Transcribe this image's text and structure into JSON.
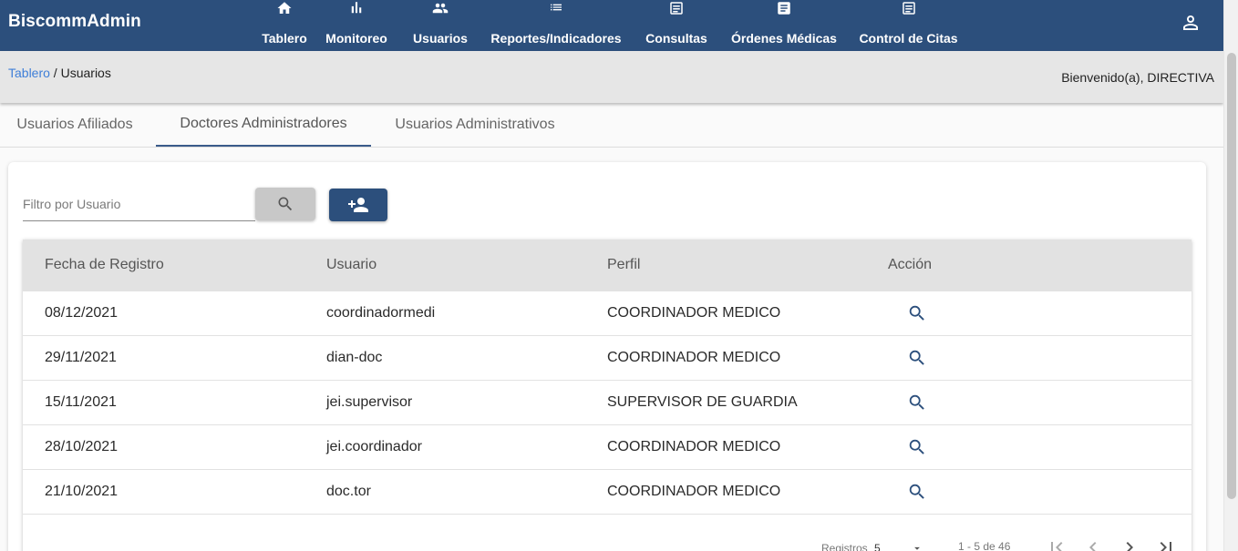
{
  "brand": "BiscommAdmin",
  "nav": [
    {
      "label": "Tablero",
      "icon": "home-icon"
    },
    {
      "label": "Monitoreo",
      "icon": "bar-chart-icon"
    },
    {
      "label": "Usuarios",
      "icon": "people-icon"
    },
    {
      "label": "Reportes/Indicadores",
      "icon": "list-icon"
    },
    {
      "label": "Consultas",
      "icon": "document-icon"
    },
    {
      "label": "Órdenes Médicas",
      "icon": "document-icon"
    },
    {
      "label": "Control de Citas",
      "icon": "document-icon"
    }
  ],
  "account_icon": "account-icon",
  "breadcrumb": {
    "link": "Tablero",
    "separator": " / ",
    "current": "Usuarios"
  },
  "welcome": "Bienvenido(a), DIRECTIVA",
  "tabs": [
    {
      "label": "Usuarios Afiliados",
      "active": false
    },
    {
      "label": "Doctores Administradores",
      "active": true
    },
    {
      "label": "Usuarios Administrativos",
      "active": false
    }
  ],
  "filter": {
    "placeholder": "Filtro por Usuario",
    "value": ""
  },
  "table": {
    "headers": [
      "Fecha de Registro",
      "Usuario",
      "Perfil",
      "Acción"
    ],
    "rows": [
      {
        "fecha": "08/12/2021",
        "usuario": "coordinadormedi",
        "perfil": "COORDINADOR MEDICO"
      },
      {
        "fecha": "29/11/2021",
        "usuario": "dian-doc",
        "perfil": "COORDINADOR MEDICO"
      },
      {
        "fecha": "15/11/2021",
        "usuario": "jei.supervisor",
        "perfil": "SUPERVISOR DE GUARDIA"
      },
      {
        "fecha": "28/10/2021",
        "usuario": "jei.coordinador",
        "perfil": "COORDINADOR MEDICO"
      },
      {
        "fecha": "21/10/2021",
        "usuario": "doc.tor",
        "perfil": "COORDINADOR MEDICO"
      }
    ]
  },
  "pagination": {
    "registros_label": "Registros",
    "page_size": "5",
    "range": "1 - 5 de 46"
  },
  "colors": {
    "primary": "#2c4f7c",
    "link": "#3f7fd8",
    "header_bg": "#e2e2e2"
  }
}
